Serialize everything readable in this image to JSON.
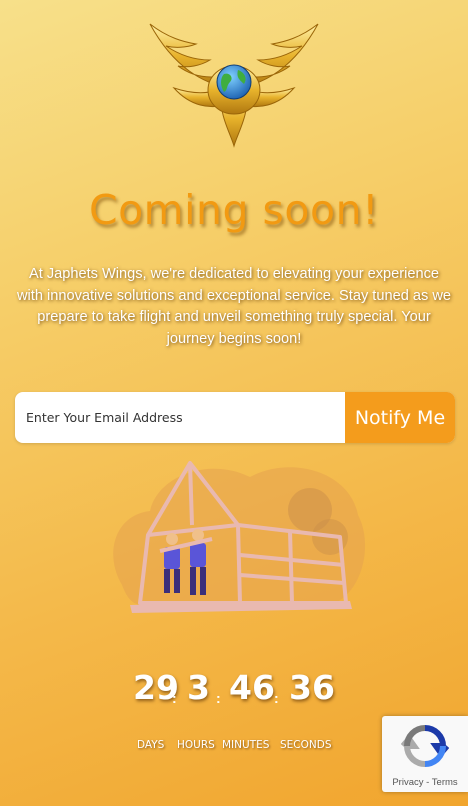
{
  "hero": {
    "title": "Coming soon!",
    "description": "At Japhets Wings, we're dedicated to elevating your experience with innovative solutions and exceptional service. Stay tuned as we prepare to take flight and unveil something truly special. Your journey begins soon!"
  },
  "logo": {
    "icon": "winged-globe-logo"
  },
  "form": {
    "email_placeholder": "Enter Your Email Address",
    "notify_label": "Notify Me"
  },
  "illustration": {
    "icon": "house-construction-illustration"
  },
  "countdown": {
    "days": "29",
    "hours": "3",
    "minutes": "46",
    "seconds": "36",
    "separator": ":",
    "labels": {
      "days": "DAYS",
      "hours": "HOURS",
      "minutes": "MINUTES",
      "seconds": "SECONDS"
    }
  },
  "recaptcha": {
    "icon": "recaptcha-icon",
    "privacy": "Privacy",
    "dash": " - ",
    "terms": "Terms"
  },
  "colors": {
    "accent": "#f49c1c",
    "title": "#f29a12",
    "background_start": "#f7e08a",
    "background_end": "#f1a52e"
  }
}
